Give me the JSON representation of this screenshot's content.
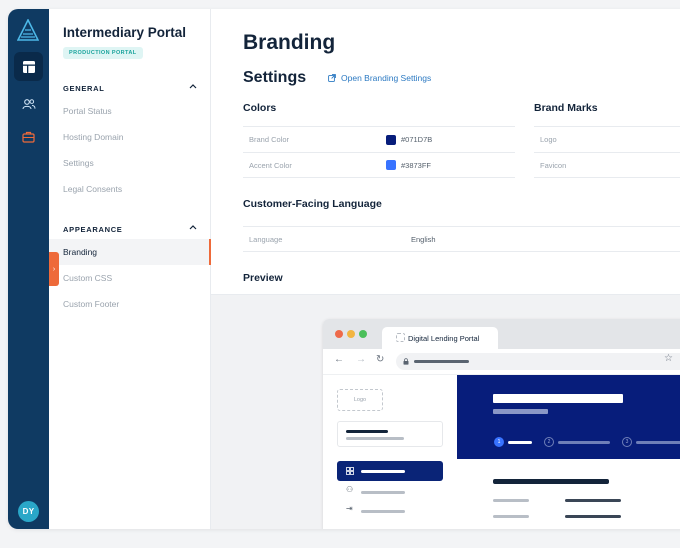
{
  "sidebar": {
    "title": "Intermediary Portal",
    "badge": "PRODUCTION PORTAL",
    "sections": [
      {
        "label": "GENERAL",
        "items": [
          "Portal Status",
          "Hosting Domain",
          "Settings",
          "Legal Consents"
        ]
      },
      {
        "label": "APPEARANCE",
        "items": [
          "Branding",
          "Custom CSS",
          "Custom Footer"
        ]
      }
    ],
    "active_item": "Branding"
  },
  "rail": {
    "avatar_initials": "DY",
    "icons": [
      "brand-logo-icon",
      "layout-icon",
      "users-icon",
      "briefcase-icon"
    ]
  },
  "main": {
    "page_title": "Branding",
    "settings_heading": "Settings",
    "open_link": "Open Branding Settings",
    "colors": {
      "heading": "Colors",
      "rows": [
        {
          "label": "Brand Color",
          "value": "#071D7B",
          "color": "#071D7B"
        },
        {
          "label": "Accent Color",
          "value": "#3873FF",
          "color": "#3873FF"
        }
      ]
    },
    "brand_marks": {
      "heading": "Brand Marks",
      "rows": [
        {
          "label": "Logo"
        },
        {
          "label": "Favicon"
        }
      ]
    },
    "language": {
      "heading": "Customer-Facing Language",
      "label": "Language",
      "value": "English"
    },
    "preview_heading": "Preview"
  },
  "preview": {
    "tab_title": "Digital Lending Portal",
    "logo_placeholder": "Logo",
    "steps": [
      "1",
      "2",
      "3"
    ]
  },
  "colors": {
    "rail_bg": "#0f3a62",
    "accent_orange": "#ee6a3a",
    "link_blue": "#2b79c2",
    "badge_bg": "#dff5f4",
    "badge_text": "#1aa39c"
  }
}
